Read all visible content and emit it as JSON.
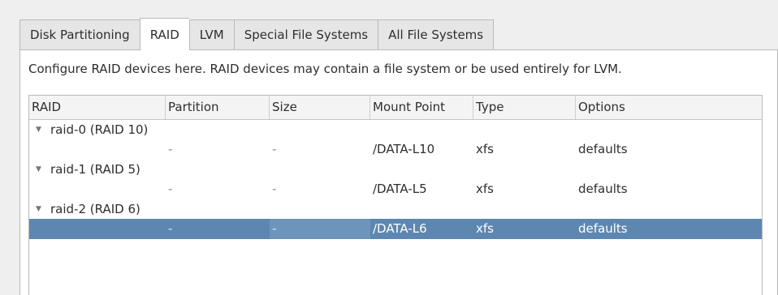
{
  "tabs": [
    {
      "label": "Disk Partitioning",
      "active": false
    },
    {
      "label": "RAID",
      "active": true
    },
    {
      "label": "LVM",
      "active": false
    },
    {
      "label": "Special File Systems",
      "active": false
    },
    {
      "label": "All File Systems",
      "active": false
    }
  ],
  "description": "Configure RAID devices here.  RAID devices may contain a file system or be used entirely for LVM.",
  "columns": {
    "raid": "RAID",
    "partition": "Partition",
    "size": "Size",
    "mount_point": "Mount Point",
    "type": "Type",
    "options": "Options"
  },
  "groups": [
    {
      "expander": "▼",
      "label": "raid-0 (RAID 10)",
      "partition": "-",
      "size": "-",
      "mount_point": "/DATA-L10",
      "type": "xfs",
      "options": "defaults",
      "selected": false
    },
    {
      "expander": "▼",
      "label": "raid-1 (RAID 5)",
      "partition": "-",
      "size": "-",
      "mount_point": "/DATA-L5",
      "type": "xfs",
      "options": "defaults",
      "selected": false
    },
    {
      "expander": "▼",
      "label": "raid-2 (RAID 6)",
      "partition": "-",
      "size": "-",
      "mount_point": "/DATA-L6",
      "type": "xfs",
      "options": "defaults",
      "selected": true
    }
  ],
  "colors": {
    "selection": "#5d87b0",
    "panel_background": "#ffffff",
    "window_background": "#efefef"
  }
}
